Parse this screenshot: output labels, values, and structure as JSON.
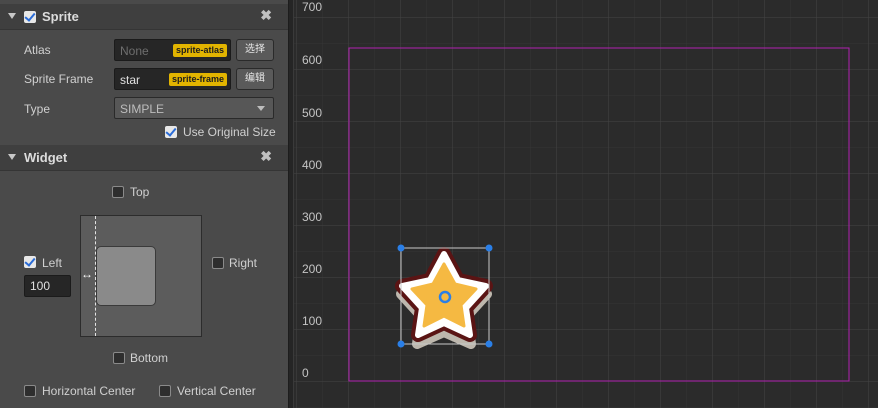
{
  "sprite": {
    "title": "Sprite",
    "atlas_label": "Atlas",
    "atlas_value": "None",
    "atlas_tag": "sprite-atlas",
    "atlas_button": "选择",
    "frame_label": "Sprite Frame",
    "frame_value": "star",
    "frame_tag": "sprite-frame",
    "frame_button": "编辑",
    "type_label": "Type",
    "type_value": "SIMPLE",
    "original_size_label": "Use Original Size"
  },
  "widget": {
    "title": "Widget",
    "top_label": "Top",
    "left_label": "Left",
    "left_value": "100",
    "right_label": "Right",
    "bottom_label": "Bottom",
    "hcenter_label": "Horizontal Center",
    "vcenter_label": "Vertical Center"
  },
  "scene": {
    "ruler_labels": [
      "700",
      "600",
      "500",
      "400",
      "300",
      "200",
      "100",
      "0"
    ]
  },
  "colors": {
    "accent_checkbox": "#2a6cd8",
    "tag": "#e2b400",
    "canvas_border": "#b020b0",
    "handle": "#2a7fe8",
    "star_fill": "#f5b942",
    "star_outline": "#5a1414"
  }
}
